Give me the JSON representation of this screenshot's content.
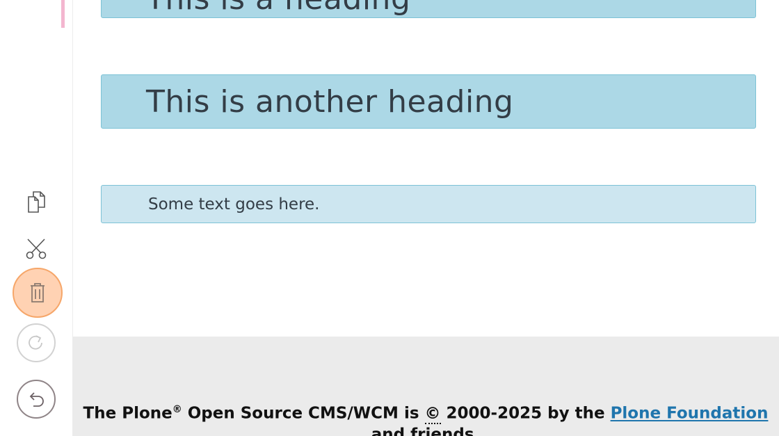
{
  "blocks": {
    "heading1": "This is a heading",
    "heading2": "This is another heading",
    "paragraph": "Some text goes here."
  },
  "toolbar": {
    "icons": [
      "copy-icon",
      "cut-icon",
      "delete-icon",
      "redo-icon",
      "undo-icon"
    ]
  },
  "footer": {
    "prefix": "The Plone",
    "registered": "®",
    "middle": " Open Source CMS/WCM is ",
    "copyright_symbol": "©",
    "years": " 2000-2025 by the ",
    "link_text": "Plone Foundation",
    "line2": "and friends."
  },
  "colors": {
    "heading_block_bg": "#acd8e6",
    "text_block_bg": "#cde6f0",
    "block_border": "#7cc2d6",
    "delete_highlight": "#ffd2b3",
    "link": "#1f75ad",
    "footer_bg": "#ebebeb"
  }
}
